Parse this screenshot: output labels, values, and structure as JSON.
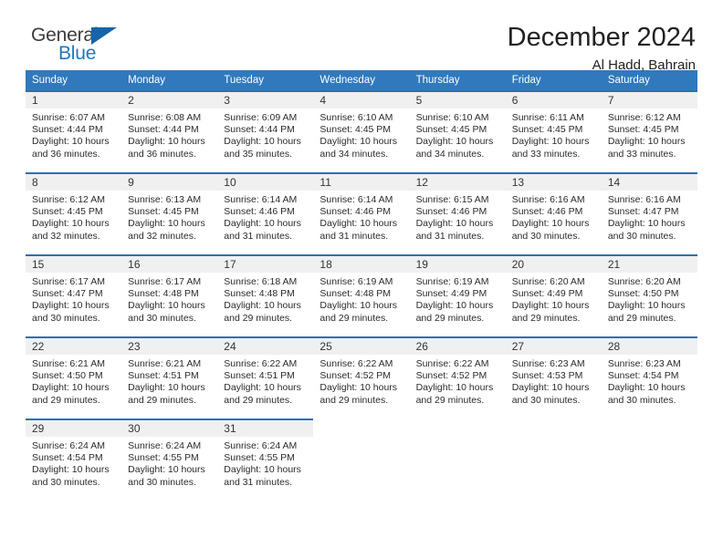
{
  "logo": {
    "word_top": "General",
    "word_bottom": "Blue",
    "triangle_color": "#1565a8",
    "blue_color": "#2077c0"
  },
  "header": {
    "title": "December 2024",
    "subtitle": "Al Hadd, Bahrain",
    "header_row_color": "#3079bd",
    "daynum_band_color": "#f0f0f0"
  },
  "weekday_headers": [
    "Sunday",
    "Monday",
    "Tuesday",
    "Wednesday",
    "Thursday",
    "Friday",
    "Saturday"
  ],
  "weeks": [
    [
      {
        "day": "1",
        "sunrise": "Sunrise: 6:07 AM",
        "sunset": "Sunset: 4:44 PM",
        "daylight1": "Daylight: 10 hours",
        "daylight2": "and 36 minutes."
      },
      {
        "day": "2",
        "sunrise": "Sunrise: 6:08 AM",
        "sunset": "Sunset: 4:44 PM",
        "daylight1": "Daylight: 10 hours",
        "daylight2": "and 36 minutes."
      },
      {
        "day": "3",
        "sunrise": "Sunrise: 6:09 AM",
        "sunset": "Sunset: 4:44 PM",
        "daylight1": "Daylight: 10 hours",
        "daylight2": "and 35 minutes."
      },
      {
        "day": "4",
        "sunrise": "Sunrise: 6:10 AM",
        "sunset": "Sunset: 4:45 PM",
        "daylight1": "Daylight: 10 hours",
        "daylight2": "and 34 minutes."
      },
      {
        "day": "5",
        "sunrise": "Sunrise: 6:10 AM",
        "sunset": "Sunset: 4:45 PM",
        "daylight1": "Daylight: 10 hours",
        "daylight2": "and 34 minutes."
      },
      {
        "day": "6",
        "sunrise": "Sunrise: 6:11 AM",
        "sunset": "Sunset: 4:45 PM",
        "daylight1": "Daylight: 10 hours",
        "daylight2": "and 33 minutes."
      },
      {
        "day": "7",
        "sunrise": "Sunrise: 6:12 AM",
        "sunset": "Sunset: 4:45 PM",
        "daylight1": "Daylight: 10 hours",
        "daylight2": "and 33 minutes."
      }
    ],
    [
      {
        "day": "8",
        "sunrise": "Sunrise: 6:12 AM",
        "sunset": "Sunset: 4:45 PM",
        "daylight1": "Daylight: 10 hours",
        "daylight2": "and 32 minutes."
      },
      {
        "day": "9",
        "sunrise": "Sunrise: 6:13 AM",
        "sunset": "Sunset: 4:45 PM",
        "daylight1": "Daylight: 10 hours",
        "daylight2": "and 32 minutes."
      },
      {
        "day": "10",
        "sunrise": "Sunrise: 6:14 AM",
        "sunset": "Sunset: 4:46 PM",
        "daylight1": "Daylight: 10 hours",
        "daylight2": "and 31 minutes."
      },
      {
        "day": "11",
        "sunrise": "Sunrise: 6:14 AM",
        "sunset": "Sunset: 4:46 PM",
        "daylight1": "Daylight: 10 hours",
        "daylight2": "and 31 minutes."
      },
      {
        "day": "12",
        "sunrise": "Sunrise: 6:15 AM",
        "sunset": "Sunset: 4:46 PM",
        "daylight1": "Daylight: 10 hours",
        "daylight2": "and 31 minutes."
      },
      {
        "day": "13",
        "sunrise": "Sunrise: 6:16 AM",
        "sunset": "Sunset: 4:46 PM",
        "daylight1": "Daylight: 10 hours",
        "daylight2": "and 30 minutes."
      },
      {
        "day": "14",
        "sunrise": "Sunrise: 6:16 AM",
        "sunset": "Sunset: 4:47 PM",
        "daylight1": "Daylight: 10 hours",
        "daylight2": "and 30 minutes."
      }
    ],
    [
      {
        "day": "15",
        "sunrise": "Sunrise: 6:17 AM",
        "sunset": "Sunset: 4:47 PM",
        "daylight1": "Daylight: 10 hours",
        "daylight2": "and 30 minutes."
      },
      {
        "day": "16",
        "sunrise": "Sunrise: 6:17 AM",
        "sunset": "Sunset: 4:48 PM",
        "daylight1": "Daylight: 10 hours",
        "daylight2": "and 30 minutes."
      },
      {
        "day": "17",
        "sunrise": "Sunrise: 6:18 AM",
        "sunset": "Sunset: 4:48 PM",
        "daylight1": "Daylight: 10 hours",
        "daylight2": "and 29 minutes."
      },
      {
        "day": "18",
        "sunrise": "Sunrise: 6:19 AM",
        "sunset": "Sunset: 4:48 PM",
        "daylight1": "Daylight: 10 hours",
        "daylight2": "and 29 minutes."
      },
      {
        "day": "19",
        "sunrise": "Sunrise: 6:19 AM",
        "sunset": "Sunset: 4:49 PM",
        "daylight1": "Daylight: 10 hours",
        "daylight2": "and 29 minutes."
      },
      {
        "day": "20",
        "sunrise": "Sunrise: 6:20 AM",
        "sunset": "Sunset: 4:49 PM",
        "daylight1": "Daylight: 10 hours",
        "daylight2": "and 29 minutes."
      },
      {
        "day": "21",
        "sunrise": "Sunrise: 6:20 AM",
        "sunset": "Sunset: 4:50 PM",
        "daylight1": "Daylight: 10 hours",
        "daylight2": "and 29 minutes."
      }
    ],
    [
      {
        "day": "22",
        "sunrise": "Sunrise: 6:21 AM",
        "sunset": "Sunset: 4:50 PM",
        "daylight1": "Daylight: 10 hours",
        "daylight2": "and 29 minutes."
      },
      {
        "day": "23",
        "sunrise": "Sunrise: 6:21 AM",
        "sunset": "Sunset: 4:51 PM",
        "daylight1": "Daylight: 10 hours",
        "daylight2": "and 29 minutes."
      },
      {
        "day": "24",
        "sunrise": "Sunrise: 6:22 AM",
        "sunset": "Sunset: 4:51 PM",
        "daylight1": "Daylight: 10 hours",
        "daylight2": "and 29 minutes."
      },
      {
        "day": "25",
        "sunrise": "Sunrise: 6:22 AM",
        "sunset": "Sunset: 4:52 PM",
        "daylight1": "Daylight: 10 hours",
        "daylight2": "and 29 minutes."
      },
      {
        "day": "26",
        "sunrise": "Sunrise: 6:22 AM",
        "sunset": "Sunset: 4:52 PM",
        "daylight1": "Daylight: 10 hours",
        "daylight2": "and 29 minutes."
      },
      {
        "day": "27",
        "sunrise": "Sunrise: 6:23 AM",
        "sunset": "Sunset: 4:53 PM",
        "daylight1": "Daylight: 10 hours",
        "daylight2": "and 30 minutes."
      },
      {
        "day": "28",
        "sunrise": "Sunrise: 6:23 AM",
        "sunset": "Sunset: 4:54 PM",
        "daylight1": "Daylight: 10 hours",
        "daylight2": "and 30 minutes."
      }
    ],
    [
      {
        "day": "29",
        "sunrise": "Sunrise: 6:24 AM",
        "sunset": "Sunset: 4:54 PM",
        "daylight1": "Daylight: 10 hours",
        "daylight2": "and 30 minutes."
      },
      {
        "day": "30",
        "sunrise": "Sunrise: 6:24 AM",
        "sunset": "Sunset: 4:55 PM",
        "daylight1": "Daylight: 10 hours",
        "daylight2": "and 30 minutes."
      },
      {
        "day": "31",
        "sunrise": "Sunrise: 6:24 AM",
        "sunset": "Sunset: 4:55 PM",
        "daylight1": "Daylight: 10 hours",
        "daylight2": "and 31 minutes."
      },
      null,
      null,
      null,
      null
    ]
  ]
}
